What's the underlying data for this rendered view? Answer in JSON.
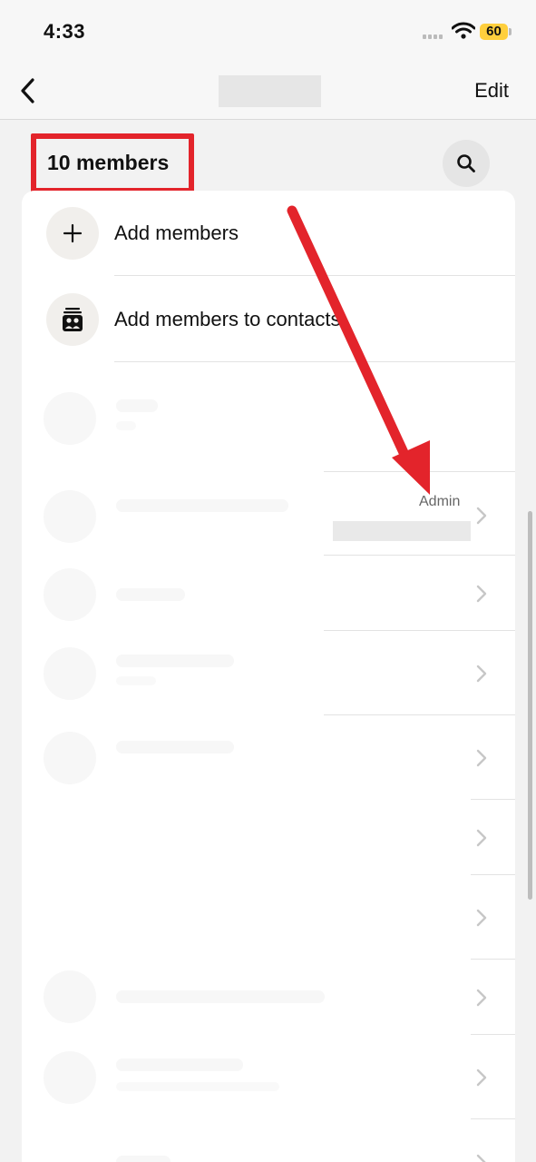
{
  "status_bar": {
    "time": "4:33",
    "battery": "60"
  },
  "nav": {
    "edit_label": "Edit"
  },
  "members": {
    "count_label": "10 members"
  },
  "actions": [
    {
      "label": "Add members"
    },
    {
      "label": "Add members to contacts"
    }
  ],
  "admin_badge": "Admin",
  "colors": {
    "highlight": "#e3242b",
    "background": "#f2f2f2",
    "battery": "#ffcf3d"
  },
  "icons": [
    "back-chevron-icon",
    "search-icon",
    "plus-icon",
    "contacts-icon",
    "chevron-right-icon",
    "wifi-icon",
    "battery-icon",
    "signal-icon"
  ]
}
